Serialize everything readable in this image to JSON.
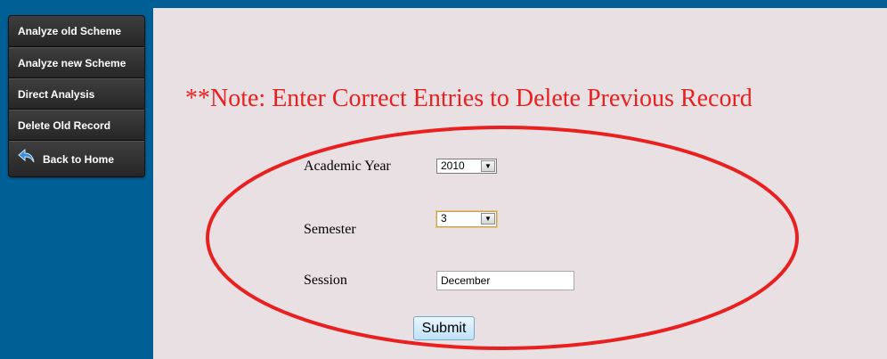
{
  "sidebar": {
    "items": [
      {
        "label": "Analyze old Scheme"
      },
      {
        "label": "Analyze new Scheme"
      },
      {
        "label": "Direct Analysis"
      },
      {
        "label": "Delete Old Record"
      },
      {
        "label": "Back to Home",
        "icon": "back-arrow-icon"
      }
    ]
  },
  "note": "**Note: Enter Correct Entries to Delete Previous Record",
  "form": {
    "academic_year": {
      "label": "Academic Year",
      "value": "2010"
    },
    "semester": {
      "label": "Semester",
      "value": "3"
    },
    "session": {
      "label": "Session",
      "value": "December"
    },
    "submit_label": "Submit"
  },
  "colors": {
    "frame": "#005f95",
    "content_background": "#e9e0e4",
    "note_text": "#e8201f",
    "annotation_ellipse": "#e8201f",
    "menu_background": "#262626"
  }
}
